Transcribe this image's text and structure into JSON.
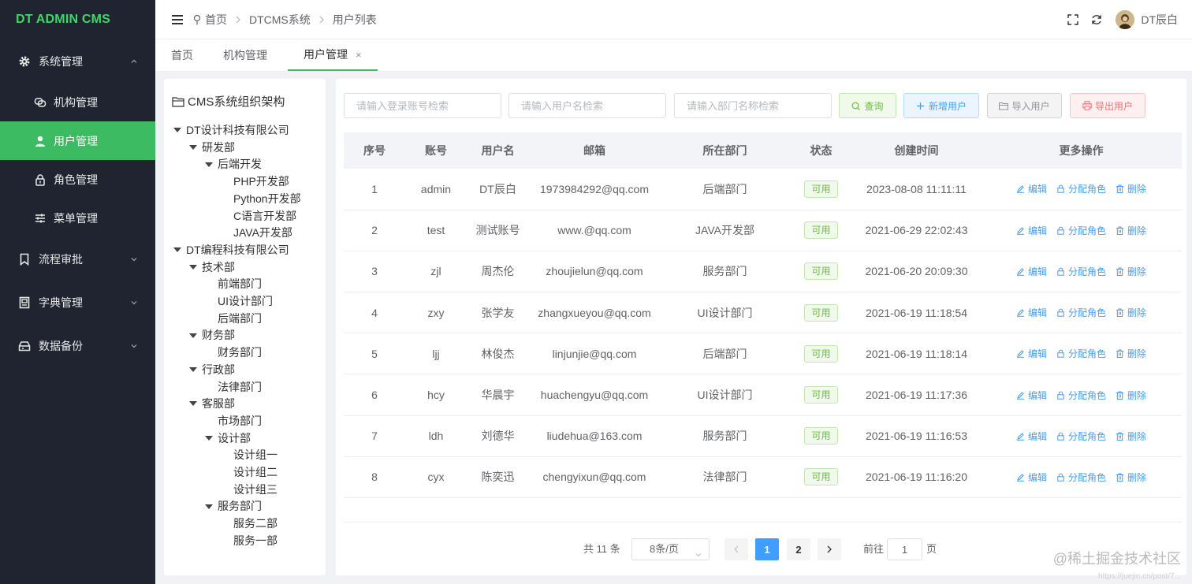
{
  "app": {
    "logo": "DT ADMIN CMS"
  },
  "sidebar": {
    "menus": [
      {
        "label": "系统管理",
        "icon": "gear-icon",
        "expanded": true,
        "children": [
          {
            "label": "机构管理",
            "icon": "org-icon",
            "active": false
          },
          {
            "label": "用户管理",
            "icon": "user-icon",
            "active": true
          },
          {
            "label": "角色管理",
            "icon": "lock-icon",
            "active": false
          },
          {
            "label": "菜单管理",
            "icon": "sliders-icon",
            "active": false
          }
        ]
      },
      {
        "label": "流程审批",
        "icon": "bookmark-icon",
        "expanded": false
      },
      {
        "label": "字典管理",
        "icon": "dictionary-icon",
        "expanded": false
      },
      {
        "label": "数据备份",
        "icon": "database-icon",
        "expanded": false
      }
    ],
    "active_color": "#3dbb62"
  },
  "header": {
    "breadcrumb": [
      "首页",
      "DTCMS系统",
      "用户列表"
    ],
    "username": "DT辰白"
  },
  "tabs": [
    {
      "label": "首页",
      "active": false
    },
    {
      "label": "机构管理",
      "active": false
    },
    {
      "label": "用户管理",
      "active": true,
      "close": "×"
    }
  ],
  "tree": {
    "title": "CMS系统组织架构",
    "nodes": [
      {
        "label": "DT设计科技有限公司"
      },
      {
        "label": "研发部"
      },
      {
        "label": "后端开发"
      },
      {
        "label": "PHP开发部"
      },
      {
        "label": "Python开发部"
      },
      {
        "label": "C语言开发部"
      },
      {
        "label": "JAVA开发部"
      },
      {
        "label": "DT编程科技有限公司"
      },
      {
        "label": "技术部"
      },
      {
        "label": "前端部门"
      },
      {
        "label": "UI设计部门"
      },
      {
        "label": "后端部门"
      },
      {
        "label": "财务部"
      },
      {
        "label": "财务部门"
      },
      {
        "label": "行政部"
      },
      {
        "label": "法律部门"
      },
      {
        "label": "客服部"
      },
      {
        "label": "市场部门"
      },
      {
        "label": "设计部"
      },
      {
        "label": "设计组一"
      },
      {
        "label": "设计组二"
      },
      {
        "label": "设计组三"
      },
      {
        "label": "服务部门"
      },
      {
        "label": "服务二部"
      },
      {
        "label": "服务一部"
      }
    ]
  },
  "search": {
    "account_placeholder": "请输入登录账号检索",
    "username_placeholder": "请输入用户名检索",
    "dept_placeholder": "请输入部门名称检索",
    "search_label": "查询",
    "add_label": "新增用户",
    "import_label": "导入用户",
    "export_label": "导出用户"
  },
  "table": {
    "columns": [
      "序号",
      "账号",
      "用户名",
      "邮箱",
      "所在部门",
      "状态",
      "创建时间",
      "更多操作"
    ],
    "rows": [
      {
        "no": "1",
        "account": "admin",
        "name": "DT辰白",
        "email": "1973984292@qq.com",
        "dept": "后端部门",
        "status": "可用",
        "created": "2023-08-08 11:11:11"
      },
      {
        "no": "2",
        "account": "test",
        "name": "测试账号",
        "email": "www.@qq.com",
        "dept": "JAVA开发部",
        "status": "可用",
        "created": "2021-06-29 22:02:43"
      },
      {
        "no": "3",
        "account": "zjl",
        "name": "周杰伦",
        "email": "zhoujielun@qq.com",
        "dept": "服务部门",
        "status": "可用",
        "created": "2021-06-20 20:09:30"
      },
      {
        "no": "4",
        "account": "zxy",
        "name": "张学友",
        "email": "zhangxueyou@qq.com",
        "dept": "UI设计部门",
        "status": "可用",
        "created": "2021-06-19 11:18:54"
      },
      {
        "no": "5",
        "account": "ljj",
        "name": "林俊杰",
        "email": "linjunjie@qq.com",
        "dept": "后端部门",
        "status": "可用",
        "created": "2021-06-19 11:18:14"
      },
      {
        "no": "6",
        "account": "hcy",
        "name": "华晨宇",
        "email": "huachengyu@qq.com",
        "dept": "UI设计部门",
        "status": "可用",
        "created": "2021-06-19 11:17:36"
      },
      {
        "no": "7",
        "account": "ldh",
        "name": "刘德华",
        "email": "liudehua@163.com",
        "dept": "服务部门",
        "status": "可用",
        "created": "2021-06-19 11:16:53"
      },
      {
        "no": "8",
        "account": "cyx",
        "name": "陈奕迅",
        "email": "chengyixun@qq.com",
        "dept": "法律部门",
        "status": "可用",
        "created": "2021-06-19 11:16:20"
      }
    ],
    "ops": {
      "edit": "编辑",
      "assign": "分配角色",
      "delete": "删除"
    }
  },
  "pagination": {
    "total": "共 11 条",
    "page_size": "8条/页",
    "pages": [
      "1",
      "2"
    ],
    "current": "1",
    "goto_prefix": "前往",
    "goto_value": "1",
    "goto_suffix": "页"
  },
  "watermark": {
    "main": "@稀土掘金技术社区",
    "sub": "https://juejin.cn/post/7..."
  }
}
